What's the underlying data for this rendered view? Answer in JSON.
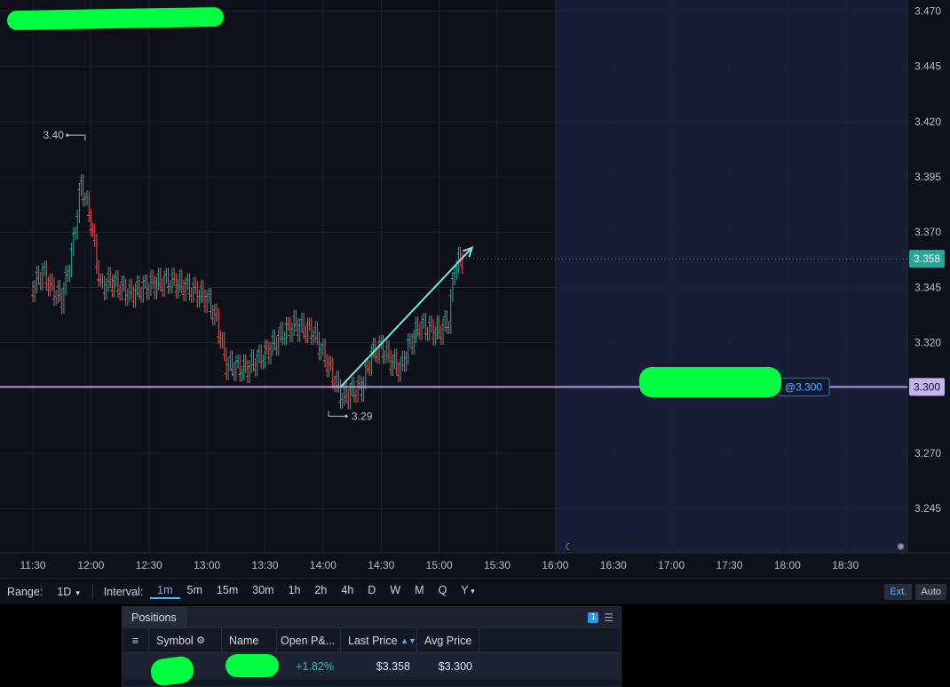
{
  "chart_data": {
    "type": "candlestick",
    "ylim": [
      3.225,
      3.475
    ],
    "yticks": [
      3.47,
      3.445,
      3.42,
      3.395,
      3.37,
      3.345,
      3.32,
      3.27,
      3.245
    ],
    "xticks": [
      "11:30",
      "12:00",
      "12:30",
      "13:00",
      "13:30",
      "14:00",
      "14:30",
      "15:00",
      "15:30",
      "16:00",
      "16:30",
      "17:00",
      "17:30",
      "18:00",
      "18:30"
    ],
    "xtick_minutes": [
      690,
      720,
      750,
      780,
      810,
      840,
      870,
      900,
      930,
      960,
      990,
      1020,
      1050,
      1080,
      1110
    ],
    "x_range_minutes": [
      673,
      1142
    ],
    "extended_hours_start": "16:00",
    "last_price": 3.358,
    "last_price_label": "3.358",
    "avg_price_line": 3.3,
    "avg_price_axis_label": "3.300",
    "avg_price_tag": "@3.300",
    "high_annotation": {
      "label": "3.40",
      "time": "11:57",
      "value": 3.405
    },
    "low_annotation": {
      "label": "3.29",
      "time": "14:12",
      "value": 3.29
    },
    "trend_arrow": {
      "from": {
        "time": "14:09",
        "value": 3.3
      },
      "to": {
        "time": "15:17",
        "value": 3.363
      }
    },
    "price_series": [
      {
        "time": "11:30",
        "value": 3.345
      },
      {
        "time": "11:35",
        "value": 3.352
      },
      {
        "time": "11:40",
        "value": 3.344
      },
      {
        "time": "11:45",
        "value": 3.34
      },
      {
        "time": "11:50",
        "value": 3.36
      },
      {
        "time": "11:55",
        "value": 3.392
      },
      {
        "time": "12:00",
        "value": 3.375
      },
      {
        "time": "12:05",
        "value": 3.345
      },
      {
        "time": "12:10",
        "value": 3.348
      },
      {
        "time": "12:15",
        "value": 3.345
      },
      {
        "time": "12:20",
        "value": 3.342
      },
      {
        "time": "12:30",
        "value": 3.346
      },
      {
        "time": "12:40",
        "value": 3.348
      },
      {
        "time": "12:50",
        "value": 3.345
      },
      {
        "time": "13:00",
        "value": 3.34
      },
      {
        "time": "13:05",
        "value": 3.33
      },
      {
        "time": "13:10",
        "value": 3.31
      },
      {
        "time": "13:20",
        "value": 3.308
      },
      {
        "time": "13:30",
        "value": 3.315
      },
      {
        "time": "13:40",
        "value": 3.325
      },
      {
        "time": "13:45",
        "value": 3.328
      },
      {
        "time": "13:55",
        "value": 3.325
      },
      {
        "time": "14:00",
        "value": 3.315
      },
      {
        "time": "14:05",
        "value": 3.305
      },
      {
        "time": "14:10",
        "value": 3.295
      },
      {
        "time": "14:15",
        "value": 3.298
      },
      {
        "time": "14:20",
        "value": 3.3
      },
      {
        "time": "14:25",
        "value": 3.315
      },
      {
        "time": "14:30",
        "value": 3.318
      },
      {
        "time": "14:35",
        "value": 3.312
      },
      {
        "time": "14:40",
        "value": 3.308
      },
      {
        "time": "14:45",
        "value": 3.32
      },
      {
        "time": "14:50",
        "value": 3.328
      },
      {
        "time": "14:55",
        "value": 3.326
      },
      {
        "time": "15:00",
        "value": 3.325
      },
      {
        "time": "15:05",
        "value": 3.33
      },
      {
        "time": "15:08",
        "value": 3.355
      },
      {
        "time": "15:12",
        "value": 3.358
      }
    ],
    "colors": {
      "up": "#26a69a",
      "down": "#ef5350",
      "avg_line": "#b39ddb",
      "last_price": "#26a69a",
      "arrow": "#7de3e0"
    }
  },
  "toolbar": {
    "range_label": "Range:",
    "range_value": "1D",
    "interval_label": "Interval:",
    "intervals": [
      "1m",
      "5m",
      "15m",
      "30m",
      "1h",
      "2h",
      "4h",
      "D",
      "W",
      "M",
      "Q",
      "Y"
    ],
    "active_interval": "1m",
    "ext_label": "Ext.",
    "auto_label": "Auto"
  },
  "positions": {
    "tab_label": "Positions",
    "count": "1",
    "columns": [
      "Symbol",
      "Name",
      "Open P&...",
      "Last Price",
      "Avg Price"
    ],
    "rows": [
      {
        "open_pnl": "+1.82%",
        "last_price": "$3.358",
        "avg_price": "$3.300"
      }
    ]
  }
}
